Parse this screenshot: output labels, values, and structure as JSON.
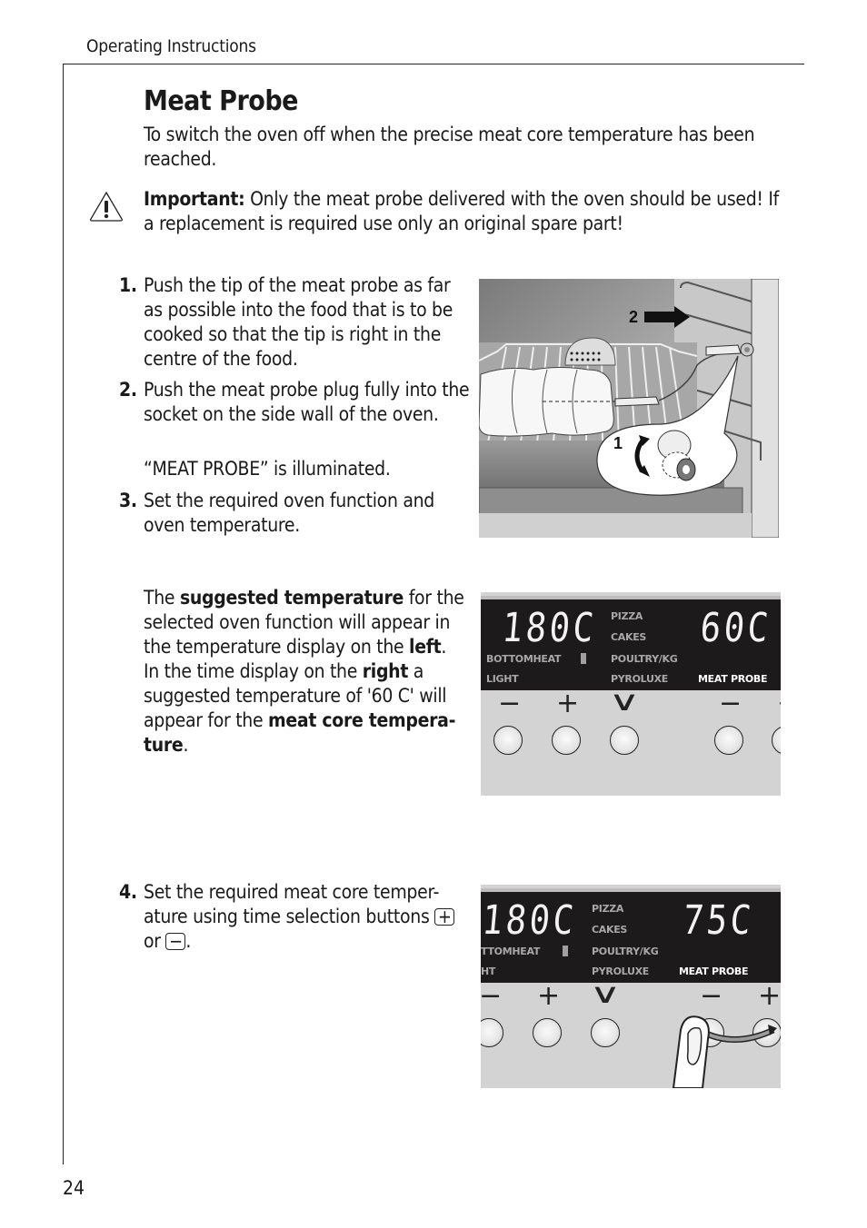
{
  "header": {
    "section": "Operating Instructions"
  },
  "page_number": "24",
  "title": "Meat Probe",
  "intro": "To switch the oven off when the precise meat core temperature has been reached.",
  "important": {
    "label": "Important:",
    "text": " Only the meat probe delivered with the oven should be used! If a replacement is required use only an original spare part!",
    "icon": "warning-triangle-icon"
  },
  "steps": [
    {
      "num": "1.",
      "text": "Push the tip of the meat probe as far as possible into the food that is to be cooked so that the tip is right in the centre of the food."
    },
    {
      "num": "2.",
      "text": "Push the meat probe plug fully into the socket on the side wall of the oven.",
      "note": "“MEAT PROBE” is illuminated."
    },
    {
      "num": "3.",
      "text": "Set the required oven function and oven temperature."
    },
    {
      "num": "4.",
      "text_before": "Set the required meat core temper-ature using time selection buttons ",
      "plus_symbol": "+",
      "or_text": " or ",
      "minus_symbol": "−",
      "text_after": "."
    }
  ],
  "paragraph": {
    "p1": "The ",
    "b1": "suggested temperature",
    "p2": " for the selected oven function will appear in the temperature display on the ",
    "b2": "left",
    "p3": ".",
    "p4": "In the time display on the ",
    "b3": "right",
    "p5": " a suggested temperature of '60 C' will appear for the ",
    "b4": "meat core tempera-ture",
    "p6": "."
  },
  "illustration": {
    "label_1": "1",
    "label_2": "2"
  },
  "panels": [
    {
      "left_display": "180C",
      "right_display": "60C",
      "labels": {
        "bottom_heat": "BOTTOMHEAT",
        "light": "LIGHT",
        "pizza": "PIZZA",
        "cakes": "CAKES",
        "poultry": "POULTRY/KG",
        "pyroluxe": "PYROLUXE",
        "meat_probe": "MEAT PROBE"
      },
      "buttons": [
        "−",
        "+",
        "∨",
        "−",
        "+"
      ]
    },
    {
      "left_display": "180C",
      "right_display": "75C",
      "labels": {
        "bottom_heat": "TTOMHEAT",
        "light": "HT",
        "pizza": "PIZZA",
        "cakes": "CAKES",
        "poultry": "POULTRY/KG",
        "pyroluxe": "PYROLUXE",
        "meat_probe": "MEAT PROBE"
      },
      "buttons": [
        "−",
        "+",
        "∨",
        "−",
        "+"
      ]
    }
  ]
}
